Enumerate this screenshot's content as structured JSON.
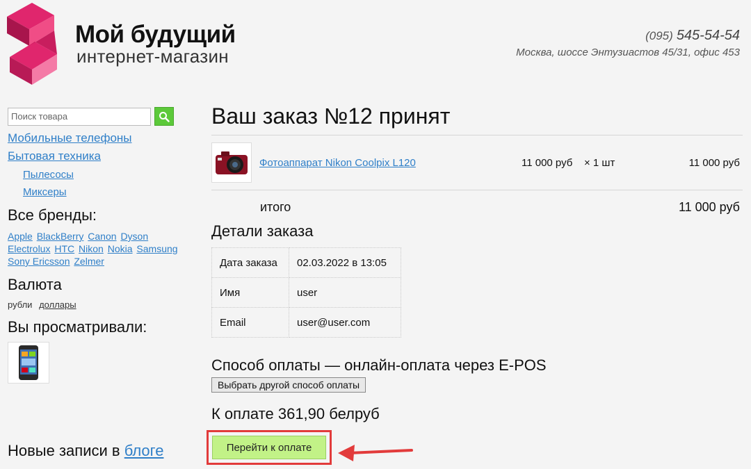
{
  "header": {
    "brand_title": "Мой будущий",
    "brand_subtitle": "интернет-магазин",
    "phone_code": "(095)",
    "phone_number": "545-54-54",
    "address": "Москва, шоссе Энтузиастов 45/31, офис 453",
    "brand_color": "#e0266d"
  },
  "sidebar": {
    "search_placeholder": "Поиск товара",
    "categories": [
      {
        "label": "Мобильные телефоны"
      },
      {
        "label": "Бытовая техника"
      }
    ],
    "subcategories": [
      {
        "label": "Пылесосы"
      },
      {
        "label": "Миксеры"
      }
    ],
    "brands_heading": "Все бренды:",
    "brands": [
      "Apple",
      "BlackBerry",
      "Canon",
      "Dyson",
      "Electrolux",
      "HTC",
      "Nikon",
      "Nokia",
      "Samsung",
      "Sony Ericsson",
      "Zelmer"
    ],
    "currency_heading": "Валюта",
    "currency_rub": "рубли",
    "currency_usd": "доллары",
    "viewed_heading": "Вы просматривали:",
    "blog_prefix": "Новые записи в",
    "blog_link": "блоге"
  },
  "order": {
    "title": "Ваш заказ №12 принят",
    "item": {
      "name": "Фотоаппарат Nikon Coolpix L120",
      "price": "11 000 руб",
      "qty": "× 1 шт",
      "total": "11 000 руб"
    },
    "total_label": "итого",
    "total_value": "11 000 руб",
    "details_heading": "Детали заказа",
    "details": [
      {
        "key": "Дата заказа",
        "value": "02.03.2022 в 13:05"
      },
      {
        "key": "Имя",
        "value": "user"
      },
      {
        "key": "Email",
        "value": "user@user.com"
      }
    ],
    "payment_method": "Способ оплаты — онлайн-оплата через E-POS",
    "change_payment_button": "Выбрать другой способ оплаты",
    "to_pay": "К оплате 361,90 белруб",
    "pay_button": "Перейти к оплате",
    "highlight_color": "#e23b3b",
    "pay_button_color": "#c2f287"
  }
}
